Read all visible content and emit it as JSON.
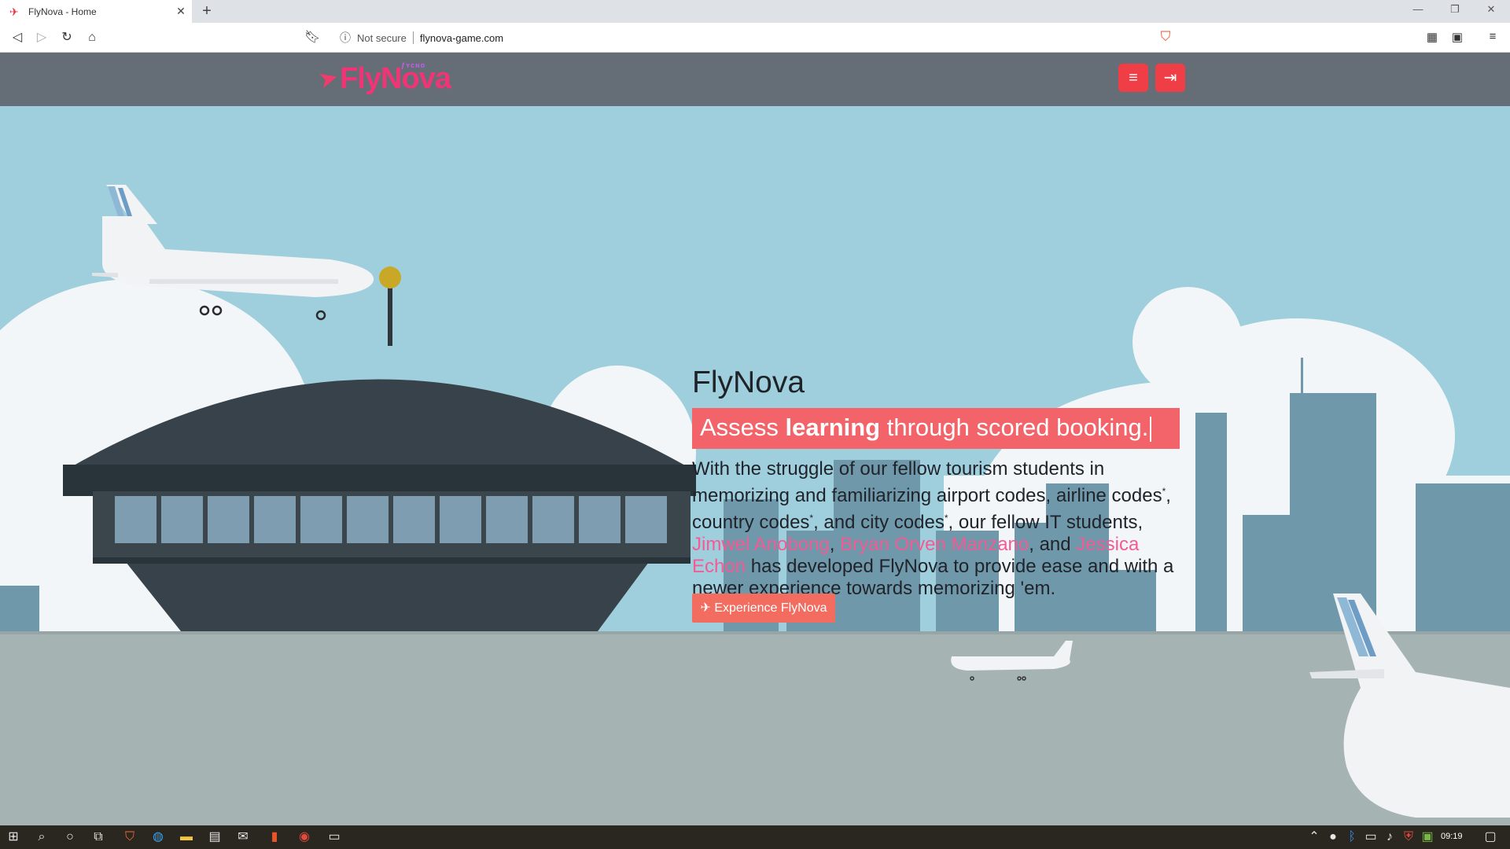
{
  "browser": {
    "tab_title": "FlyNova - Home",
    "tab_close": "✕",
    "new_tab": "+",
    "not_secure": "Not secure",
    "url": "flynova-game.com"
  },
  "site": {
    "logo_text": "FlyNova",
    "logo_sub": "ƒʏᴄɴᴏ",
    "filter_icon": "≡",
    "login_icon": "⇥"
  },
  "hero": {
    "title": "FlyNova",
    "tagline_part1": "Assess ",
    "tagline_bold": "learning",
    "tagline_part2": " through scored booking.",
    "body_1": "With the struggle of our fellow tourism students in memorizing and familiarizing airport codes, airline codes",
    "body_star": "*",
    "body_2": ", country codes",
    "body_3": ", and city codes",
    "body_4": ", our fellow IT students, ",
    "author_1": "Jimwel Anobong",
    "sep_1": ", ",
    "author_2": "Bryan Orven Manzano",
    "sep_2": ", and ",
    "author_3": "Jessica Echon",
    "body_5": " has developed FlyNova to provide ease and with a newer experience towards memorizing 'em.",
    "cta_label": "✈ Experience FlyNova"
  },
  "taskbar": {
    "time": "09:19"
  },
  "colors": {
    "sky": "#9fcfdd",
    "header": "#656d76",
    "accent_red": "#ef3e46",
    "tagline_bg": "#f2636a",
    "author_pink": "#f35b94",
    "cta": "#f26c5f"
  }
}
